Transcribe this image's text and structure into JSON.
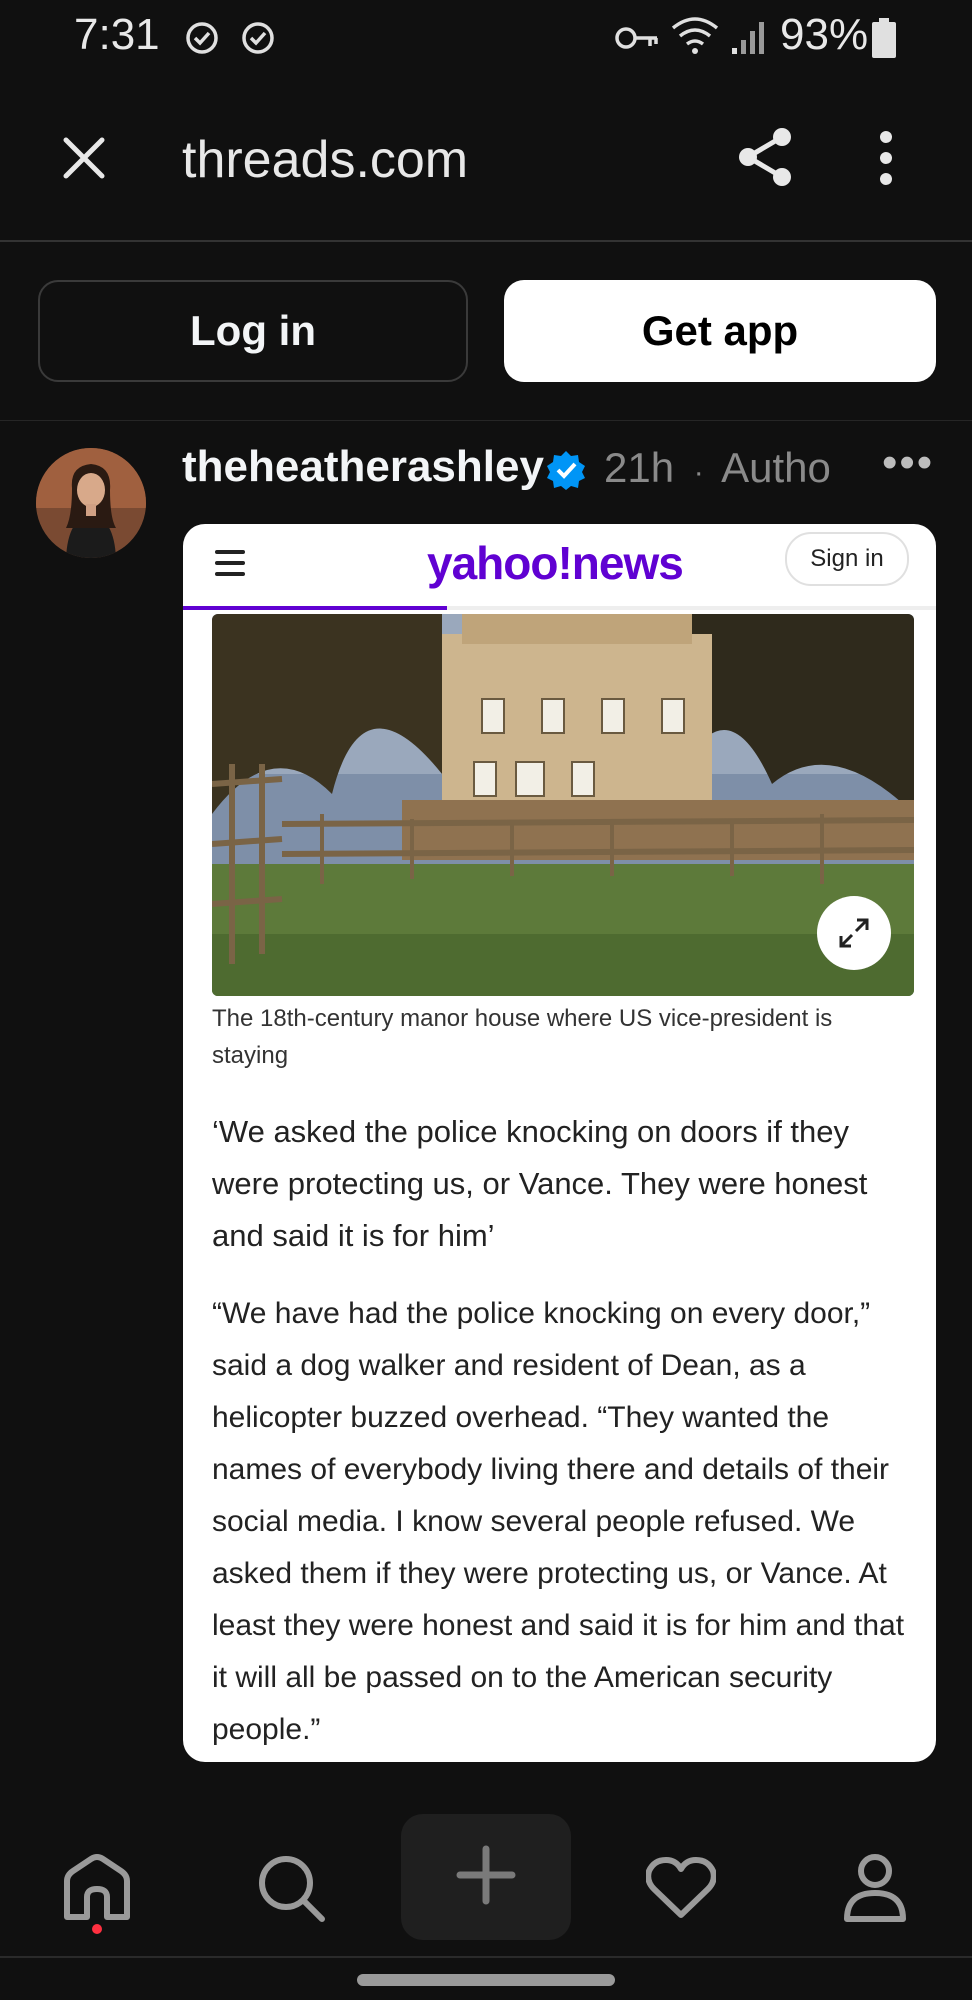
{
  "status_bar": {
    "time": "7:31",
    "battery": "93%"
  },
  "browser": {
    "url": "threads.com"
  },
  "auth": {
    "login_label": "Log in",
    "getapp_label": "Get app"
  },
  "post": {
    "username": "theheatherashley",
    "time_ago": "21h",
    "separator": "·",
    "author_tag": "Autho",
    "more": "•••"
  },
  "card": {
    "logo": "yahoo!news",
    "signin_label": "Sign in",
    "read_progress": 0.35,
    "caption": "The 18th-century manor house where US vice-president is staying",
    "subhead": "‘We asked the police knocking on doors if they were protecting us, or Vance. They were honest and said it is for him’",
    "body": "“We have had the police knocking on every door,” said a dog walker and resident of Dean, as a helicopter buzzed overhead. “They wanted the names of everybody living there and details of their social media. I know several people refused. We asked them if they were protecting us, or Vance. At least they were honest and said it is for him and that it will all be passed on to the American security people.”"
  },
  "colors": {
    "background": "#101010",
    "yahoo_purple": "#6001d2",
    "verified_blue": "#0095f6",
    "notification_red": "#ff3040"
  },
  "nav": {
    "items": [
      "home-icon",
      "search-icon",
      "plus-icon",
      "heart-icon",
      "profile-icon"
    ]
  }
}
